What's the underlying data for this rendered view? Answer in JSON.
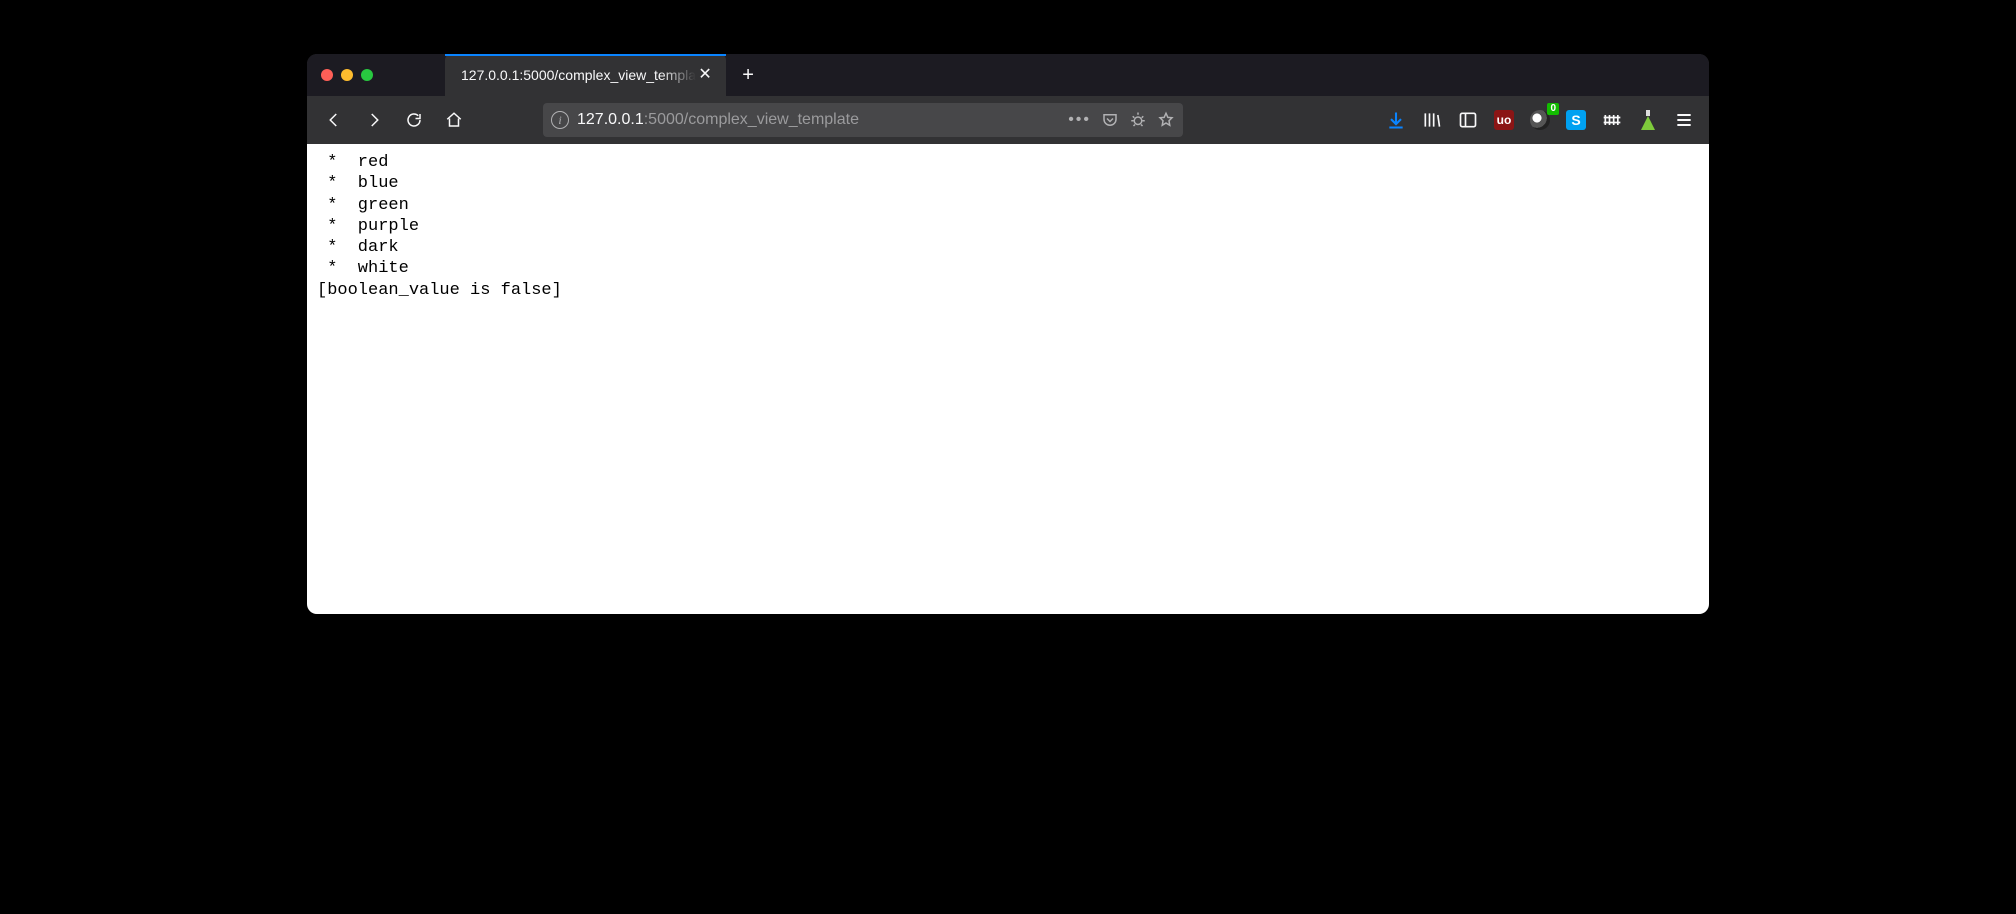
{
  "window": {
    "tab_title": "127.0.0.1:5000/complex_view_templa",
    "url_host": "127.0.0.1",
    "url_port": ":5000",
    "url_path": "/complex_view_template"
  },
  "toolbar": {
    "badger_count": "0",
    "ublock_label": "uo",
    "s_label": "S"
  },
  "page": {
    "bullet": "*",
    "items": [
      "red",
      "blue",
      "green",
      "purple",
      "dark",
      "white"
    ],
    "boolean_line": "[boolean_value is false]"
  }
}
